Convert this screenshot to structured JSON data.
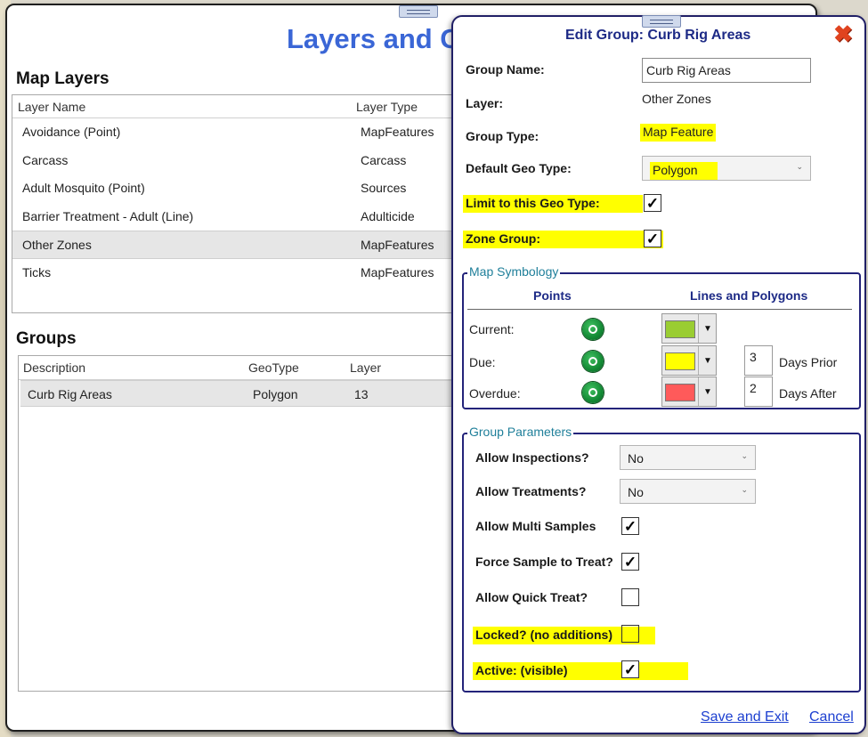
{
  "background_window": {
    "title": "Layers and G",
    "map_layers_heading": "Map Layers",
    "layers_columns": [
      "Layer Name",
      "Layer Type"
    ],
    "layers": [
      {
        "name": "Avoidance (Point)",
        "type": "MapFeatures"
      },
      {
        "name": "Carcass",
        "type": "Carcass"
      },
      {
        "name": "Adult Mosquito (Point)",
        "type": "Sources"
      },
      {
        "name": "Barrier Treatment - Adult (Line)",
        "type": "Adulticide"
      },
      {
        "name": "Other Zones",
        "type": "MapFeatures",
        "selected": true
      },
      {
        "name": "Ticks",
        "type": "MapFeatures"
      }
    ],
    "groups_heading": "Groups",
    "groups_columns": [
      "Description",
      "GeoType",
      "Layer"
    ],
    "groups": [
      {
        "description": "Curb Rig Areas",
        "geotype": "Polygon",
        "layer": "13"
      }
    ]
  },
  "dialog": {
    "title": "Edit Group: Curb Rig Areas",
    "close_icon": "close-x-icon",
    "group_name_label": "Group Name:",
    "group_name_value": "Curb Rig Areas",
    "layer_label": "Layer:",
    "layer_value": "Other Zones",
    "group_type_label": "Group Type:",
    "group_type_value": "Map Feature",
    "default_geo_type_label": "Default Geo Type:",
    "default_geo_type_value": "Polygon",
    "limit_geo_type_label": "Limit to this Geo Type:",
    "limit_geo_type_checked": true,
    "zone_group_label": "Zone Group:",
    "zone_group_checked": true,
    "map_symbology": {
      "legend": "Map Symbology",
      "points_header": "Points",
      "lines_header": "Lines and Polygons",
      "rows": [
        {
          "label": "Current:",
          "color": "#9acd32"
        },
        {
          "label": "Due:",
          "color": "#ffff00",
          "days": "3",
          "days_label": "Days Prior"
        },
        {
          "label": "Overdue:",
          "color": "#ff5a5a",
          "days": "2",
          "days_label": "Days After"
        }
      ]
    },
    "group_parameters": {
      "legend": "Group Parameters",
      "allow_inspections_label": "Allow Inspections?",
      "allow_inspections_value": "No",
      "allow_treatments_label": "Allow Treatments?",
      "allow_treatments_value": "No",
      "allow_multi_samples_label": "Allow Multi Samples",
      "allow_multi_samples_checked": true,
      "force_sample_label": "Force Sample to Treat?",
      "force_sample_checked": true,
      "allow_quick_treat_label": "Allow Quick Treat?",
      "allow_quick_treat_checked": false,
      "locked_label": "Locked? (no additions)",
      "locked_checked": false,
      "active_label": "Active: (visible)",
      "active_checked": true
    },
    "save_label": "Save and Exit",
    "cancel_label": "Cancel"
  }
}
